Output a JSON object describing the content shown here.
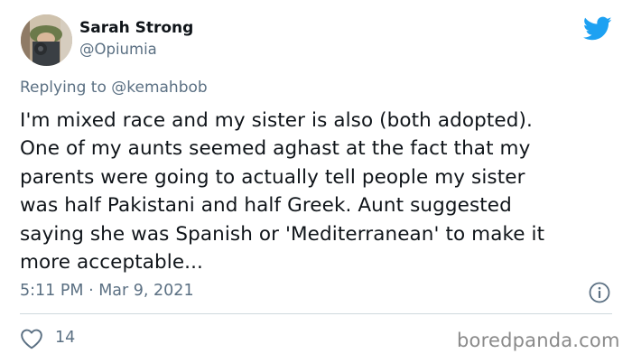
{
  "tweet": {
    "author_name": "Sarah Strong",
    "author_handle": "@Opiumia",
    "reply_prefix": "Replying to",
    "reply_mention": "@kemahbob",
    "text_lines": [
      "I'm mixed race and my sister is also (both adopted).",
      "One of my aunts seemed aghast at the fact that my",
      "parents were going to actually tell people my sister",
      "was half Pakistani and half Greek. Aunt suggested",
      "saying she was Spanish or 'Mediterranean' to make it",
      "more acceptable..."
    ],
    "timestamp": "5:11 PM · Mar 9, 2021",
    "like_count": "14"
  },
  "icons": {
    "platform": "twitter-bird-icon",
    "info": "info-icon",
    "like": "heart-icon"
  },
  "colors": {
    "brand_blue": "#1da1f2",
    "secondary_text": "#5b7083",
    "primary_text": "#0f1419",
    "divider": "#cfd9de"
  },
  "watermark": "boredpanda.com"
}
